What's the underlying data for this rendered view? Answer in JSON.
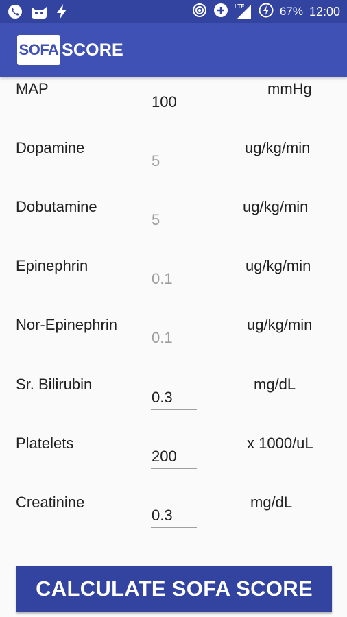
{
  "status_bar": {
    "battery_percent": "67%",
    "time": "12:00",
    "network_label": "LTE",
    "icons": [
      "whatsapp-icon",
      "cat-icon",
      "flash-icon",
      "hotspot-icon",
      "data-saver-icon",
      "signal-icon",
      "battery-icon"
    ]
  },
  "app_bar": {
    "logo_box_text": "SOFA",
    "logo_text": "SCORE"
  },
  "form": {
    "rows": [
      {
        "label": "MAP",
        "value": "100",
        "placeholder": "",
        "unit": "mmHg"
      },
      {
        "label": "Dopamine",
        "value": "",
        "placeholder": "5",
        "unit": "ug/kg/min"
      },
      {
        "label": "Dobutamine",
        "value": "",
        "placeholder": "5",
        "unit": "ug/kg/min"
      },
      {
        "label": "Epinephrin",
        "value": "",
        "placeholder": "0.1",
        "unit": "ug/kg/min"
      },
      {
        "label": "Nor-Epinephrin",
        "value": "",
        "placeholder": "0.1",
        "unit": "ug/kg/min"
      },
      {
        "label": "Sr. Bilirubin",
        "value": "0.3",
        "placeholder": "",
        "unit": "mg/dL"
      },
      {
        "label": "Platelets",
        "value": "200",
        "placeholder": "",
        "unit": "x 1000/uL"
      },
      {
        "label": "Creatinine",
        "value": "0.3",
        "placeholder": "",
        "unit": "mg/dL"
      }
    ]
  },
  "calculate_button": {
    "label": "CALCULATE SOFA SCORE"
  },
  "colors": {
    "primary": "#3f51b5",
    "primary_dark": "#3344a0",
    "background": "#fafafa",
    "hint_text": "#9e9e9e"
  }
}
